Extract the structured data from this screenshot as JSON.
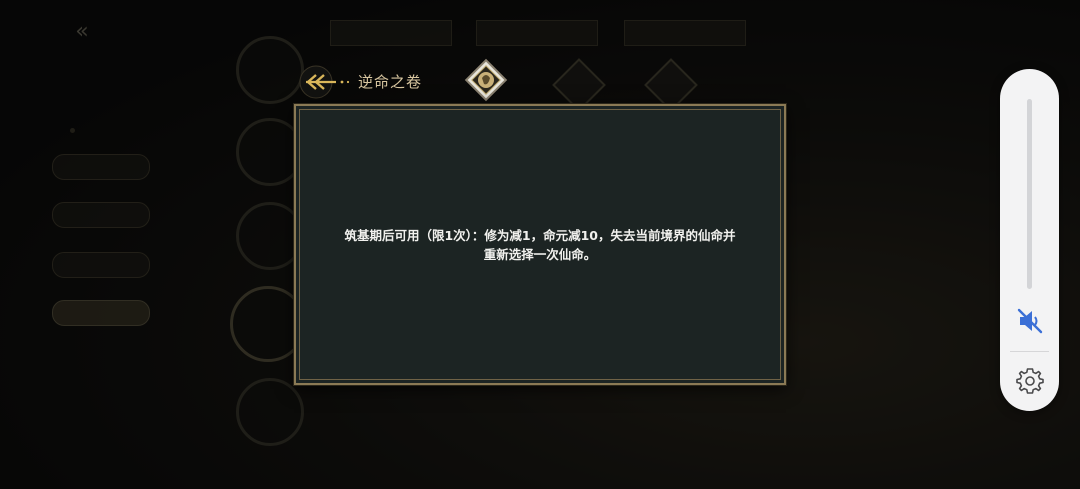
{
  "header": {
    "title": "逆命之卷",
    "back_icon": "arrow-back-icon",
    "emblem_icon": "talisman-emblem-icon"
  },
  "dialog": {
    "line1": "筑基期后可用（限1次）：修为减1，命元减10，失去当前境界的仙命并",
    "line2": "重新选择一次仙命。"
  },
  "volume_panel": {
    "mute_icon": "volume-muted-icon",
    "settings_icon": "gear-icon",
    "accent_color": "#3b6fd6"
  },
  "colors": {
    "dialog_bg": "#1c2423",
    "dialog_border": "#8b7a55",
    "title_text": "#d8c6a0"
  }
}
